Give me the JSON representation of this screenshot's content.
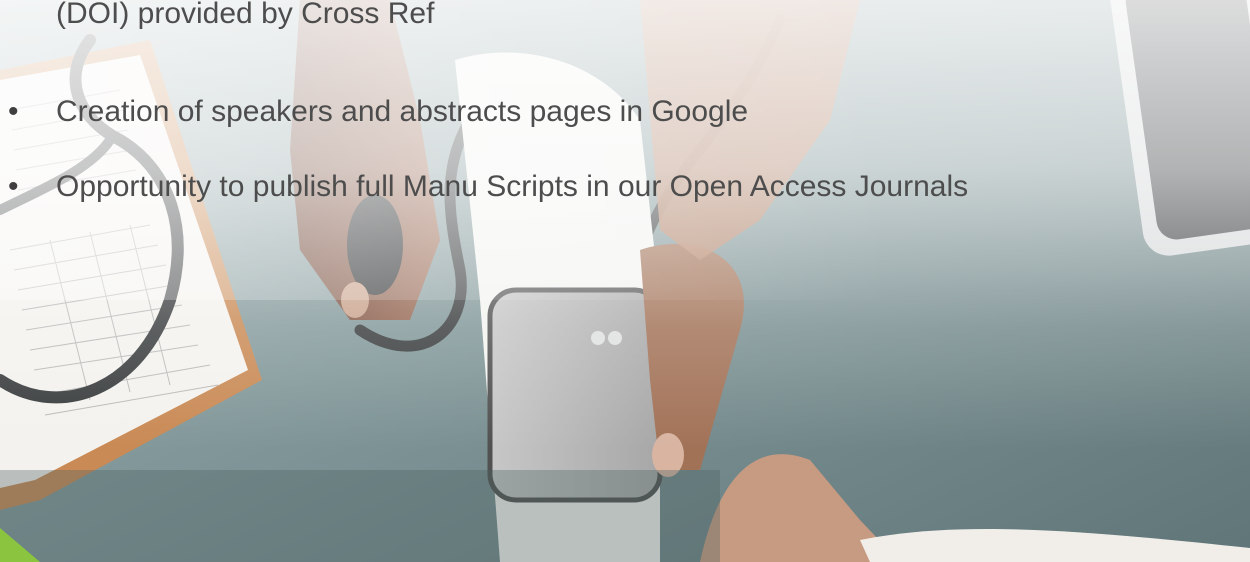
{
  "bullets": {
    "line_continuation_top": "(DOI) provided by Cross Ref",
    "items": [
      "Creation of speakers and abstracts pages in Google",
      "Opportunity to publish full Manu Scripts in our Open Access Journals"
    ],
    "bullet_glyph": "•"
  },
  "colors": {
    "text": "#4d4d4d",
    "accent_green": "#8bc53f",
    "table_surface": "#7e9496"
  },
  "icons": {
    "corner": "green-corner-triangle"
  }
}
